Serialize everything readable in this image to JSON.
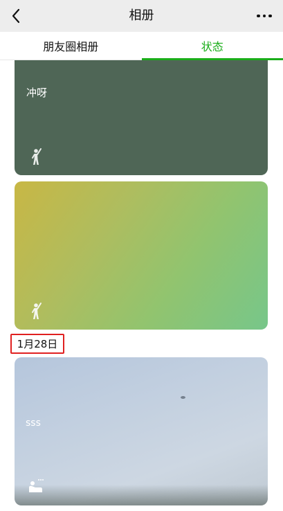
{
  "navbar": {
    "title": "相册",
    "back_icon": "chevron-left-icon",
    "more_icon": "more-dots-icon"
  },
  "tabs": [
    {
      "label": "朋友圈相册",
      "active": false
    },
    {
      "label": "状态",
      "active": true
    }
  ],
  "colors": {
    "accent": "#1aad19",
    "highlight_border": "#e02020"
  },
  "entries": [
    {
      "text": "冲呀",
      "icon": "cheer-person-icon"
    },
    {
      "text": "",
      "icon": "cheer-person-icon"
    }
  ],
  "date_group": {
    "label": "1月28日",
    "entries": [
      {
        "text": "sss",
        "icon": "resting-person-icon"
      }
    ]
  }
}
